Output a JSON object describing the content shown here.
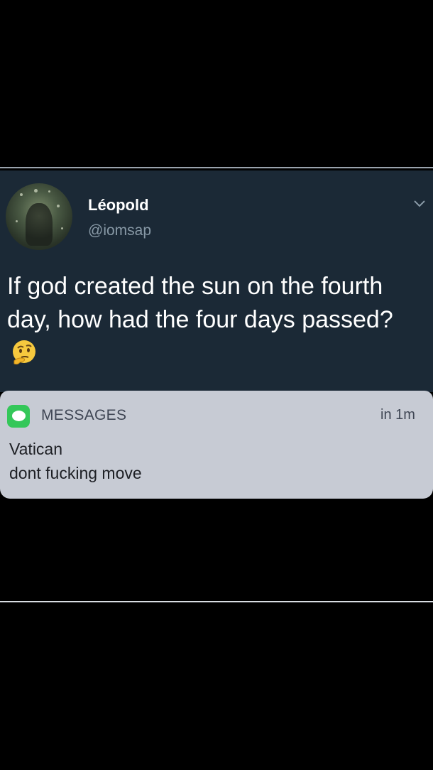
{
  "tweet": {
    "display_name": "Léopold",
    "handle": "@iomsap",
    "text": "If god created the sun on the fourth day, how had the four days passed?",
    "emoji": "thinking-face-emoji",
    "menu_icon": "chevron-down-icon"
  },
  "notification": {
    "app_icon": "messages-icon",
    "app_name": "MESSAGES",
    "time": "in 1m",
    "sender": "Vatican",
    "message": "dont fucking move"
  },
  "colors": {
    "page_bg": "#000000",
    "tweet_bg": "#1b2936",
    "handle_gray": "#8899a6",
    "notification_bg": "#c7cbd4",
    "messages_green": "#34c759"
  }
}
